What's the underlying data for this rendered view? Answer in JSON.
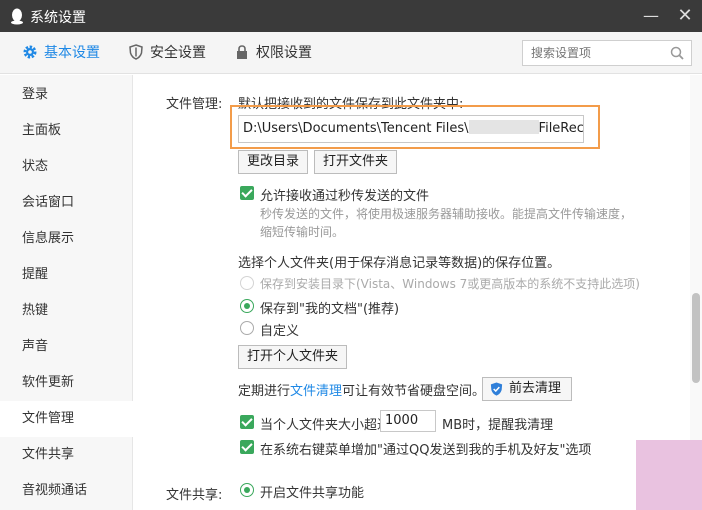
{
  "window": {
    "title": "系统设置",
    "min_glyph": "—",
    "close_glyph": "✕"
  },
  "tabs": [
    {
      "label": "基本设置",
      "icon": "gear-icon",
      "active": true
    },
    {
      "label": "安全设置",
      "icon": "shield-icon"
    },
    {
      "label": "权限设置",
      "icon": "lock-icon"
    }
  ],
  "search": {
    "placeholder": "搜索设置项"
  },
  "sidebar": {
    "items": [
      "登录",
      "主面板",
      "状态",
      "会话窗口",
      "信息展示",
      "提醒",
      "热键",
      "声音",
      "软件更新",
      "文件管理",
      "文件共享",
      "音视频通话"
    ],
    "active_index": 9
  },
  "file_management": {
    "label": "文件管理:",
    "save_location_text": "默认把接收到的文件保存到此文件夹中:",
    "path_value": "D:\\Users\\Documents\\Tencent Files\\",
    "path_suffix": "FileRecv\\",
    "change_dir_button": "更改目录",
    "open_folder_button": "打开文件夹",
    "allow_fast_transfer": {
      "label": "允许接收通过秒传发送的文件",
      "checked": true
    },
    "fast_transfer_desc": "秒传发送的文件，将使用极速服务器辅助接收。能提高文件传输速度，缩短传输时间。",
    "personal_folder_title": "选择个人文件夹(用于保存消息记录等数据)的保存位置。",
    "radio_options": [
      {
        "label": "保存到安装目录下(Vista、Windows 7或更高版本的系统不支持此选项)",
        "disabled": true,
        "checked": false
      },
      {
        "label": "保存到\"我的文档\"(推荐)",
        "checked": true
      },
      {
        "label": "自定义",
        "checked": false
      }
    ],
    "open_personal_folder_button": "打开个人文件夹",
    "clean_text_prefix": "定期进行",
    "clean_link": "文件清理",
    "clean_text_suffix": "可让有效节省硬盘空间。",
    "clean_button": "前去清理",
    "size_limit": {
      "prefix": "当个人文件夹大小超过",
      "value": "1000",
      "suffix": "MB时，提醒我清理",
      "checked": true
    },
    "context_menu": {
      "label": "在系统右键菜单增加\"通过QQ发送到我的手机及好友\"选项",
      "checked": true
    }
  },
  "file_sharing": {
    "label": "文件共享:",
    "enable": {
      "label": "开启文件共享功能",
      "checked": true
    }
  },
  "colors": {
    "accent": "#1e88e5",
    "check_green": "#3aa85c",
    "highlight_orange": "#f39c4a"
  }
}
